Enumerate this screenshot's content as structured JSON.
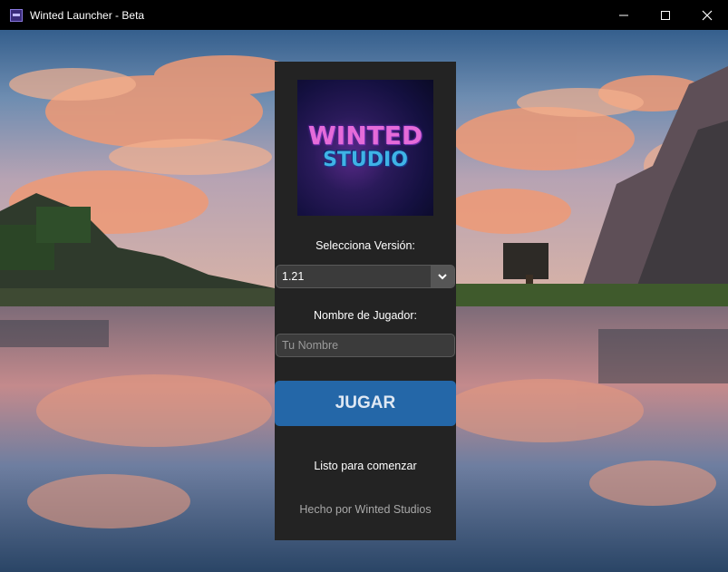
{
  "window": {
    "title": "Winted Launcher - Beta",
    "app_icon": "launcher-icon",
    "controls": {
      "minimize_icon": "minimize-icon",
      "maximize_icon": "maximize-icon",
      "close_icon": "close-icon"
    }
  },
  "logo": {
    "line1": "WINTED",
    "line2": "STUDIO"
  },
  "version": {
    "label": "Selecciona Versión:",
    "selected": "1.21",
    "arrow_icon": "chevron-down-icon"
  },
  "player": {
    "label": "Nombre de Jugador:",
    "value": "",
    "placeholder": "Tu Nombre"
  },
  "play_button": {
    "label": "JUGAR"
  },
  "status": {
    "text": "Listo para comenzar"
  },
  "footer": {
    "text": "Hecho por Winted Studios"
  },
  "colors": {
    "panel_bg": "#232323",
    "accent": "#2467a8",
    "titlebar_bg": "#000000"
  }
}
